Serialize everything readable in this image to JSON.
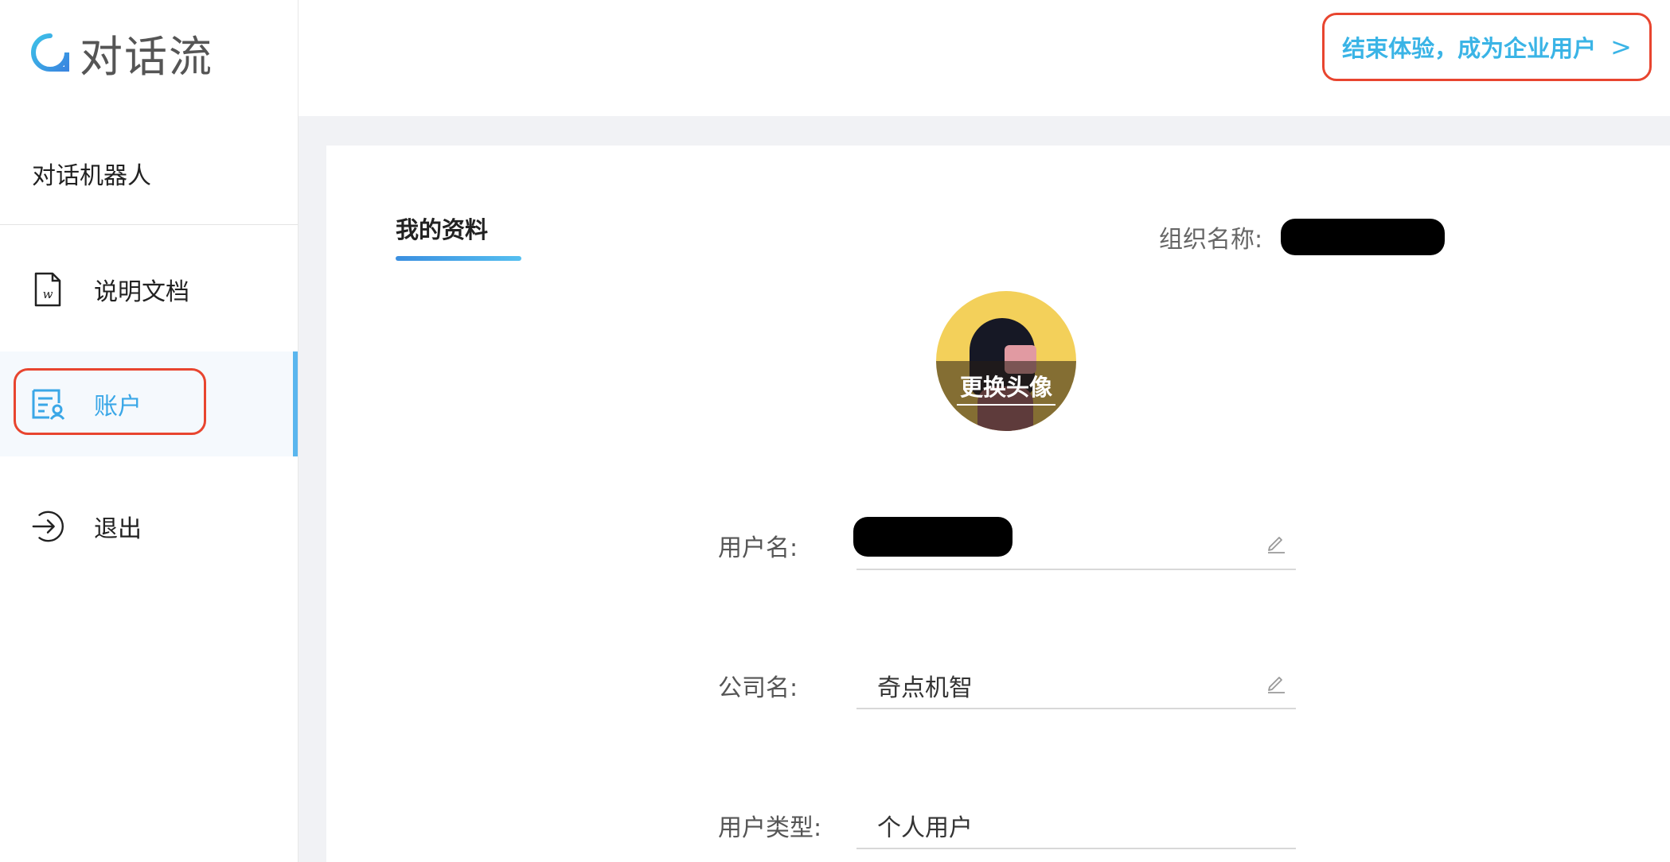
{
  "app": {
    "logo_text": "对话流"
  },
  "sidebar": {
    "section_title": "对话机器人",
    "items": [
      {
        "label": "说明文档",
        "icon": "document-w-icon"
      },
      {
        "label": "账户",
        "icon": "account-card-icon",
        "active": true
      },
      {
        "label": "退出",
        "icon": "logout-icon"
      }
    ]
  },
  "topbar": {
    "upgrade_label": "结束体验，成为企业用户",
    "upgrade_chevron": ">"
  },
  "profile": {
    "tab_label": "我的资料",
    "org_label": "组织名称:",
    "avatar_change_label": "更换头像",
    "fields": [
      {
        "label": "用户名:",
        "value": ""
      },
      {
        "label": "公司名:",
        "value": "奇点机智"
      },
      {
        "label": "用户类型:",
        "value": "个人用户"
      }
    ]
  },
  "colors": {
    "accent": "#3ab4e6",
    "highlight_box": "#e8452f",
    "content_bg": "#f1f2f5"
  }
}
